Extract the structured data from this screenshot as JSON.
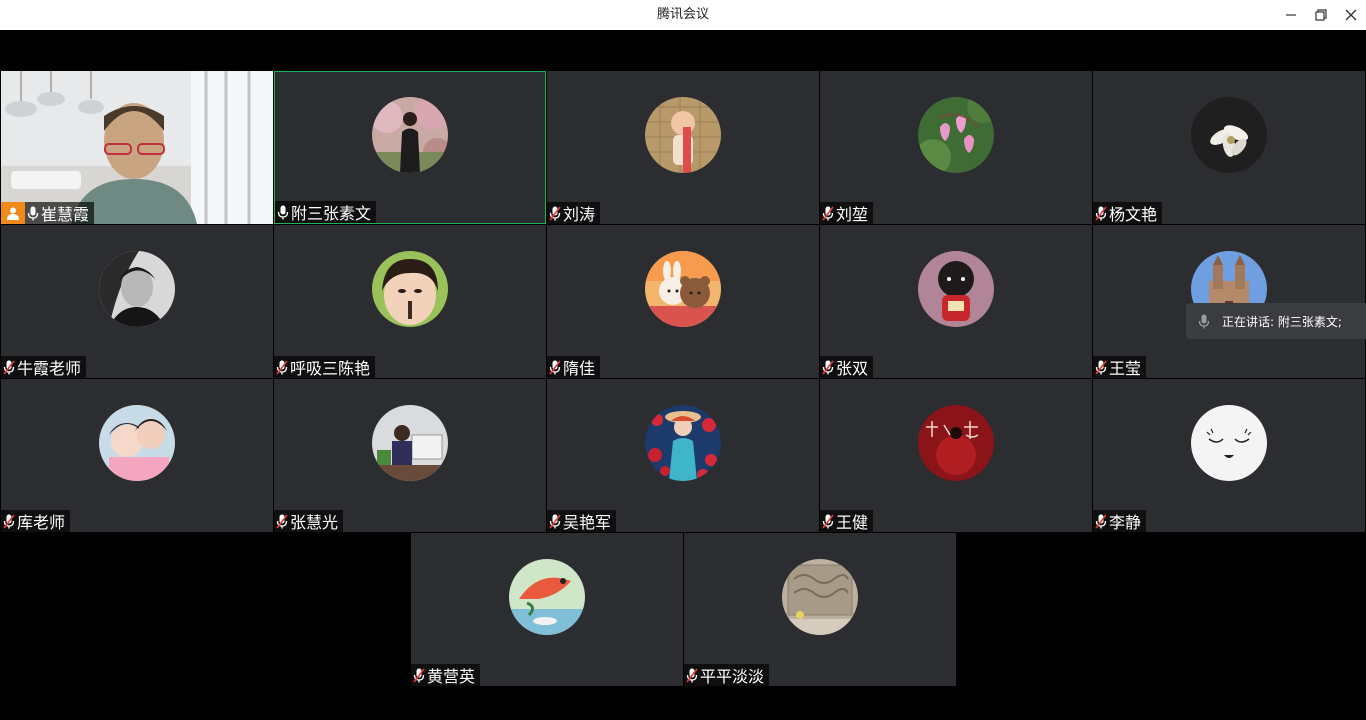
{
  "window": {
    "title": "腾讯会议"
  },
  "speaking": {
    "label": "正在讲话: 附三张素文;"
  },
  "participants": [
    {
      "name": "崔慧霞",
      "muted": false,
      "host": true,
      "video": true
    },
    {
      "name": "附三张素文",
      "muted": false,
      "active": true,
      "avatar": "blossom"
    },
    {
      "name": "刘涛",
      "muted": true,
      "avatar": "baby"
    },
    {
      "name": "刘堃",
      "muted": true,
      "avatar": "bleedingheart"
    },
    {
      "name": "杨文艳",
      "muted": true,
      "avatar": "magnolia"
    },
    {
      "name": "牛霞老师",
      "muted": true,
      "avatar": "bw-portrait"
    },
    {
      "name": "呼吸三陈艳",
      "muted": true,
      "avatar": "girl"
    },
    {
      "name": "隋佳",
      "muted": true,
      "avatar": "bears"
    },
    {
      "name": "张双",
      "muted": true,
      "avatar": "cartoon-girl"
    },
    {
      "name": "王莹",
      "muted": true,
      "avatar": "church"
    },
    {
      "name": "库老师",
      "muted": true,
      "avatar": "selfie"
    },
    {
      "name": "张慧光",
      "muted": true,
      "avatar": "child-desk"
    },
    {
      "name": "吴艳军",
      "muted": true,
      "avatar": "roses"
    },
    {
      "name": "王健",
      "muted": true,
      "avatar": "calligraphy"
    },
    {
      "name": "李静",
      "muted": true,
      "avatar": "smiley"
    },
    {
      "name": "黄营英",
      "muted": true,
      "avatar": "fish"
    },
    {
      "name": "平平淡淡",
      "muted": true,
      "avatar": "relief-wall"
    }
  ],
  "colors": {
    "tile_bg": "#2b2d30",
    "active_border": "#1fb35b",
    "host_badge": "#f28a1b"
  }
}
